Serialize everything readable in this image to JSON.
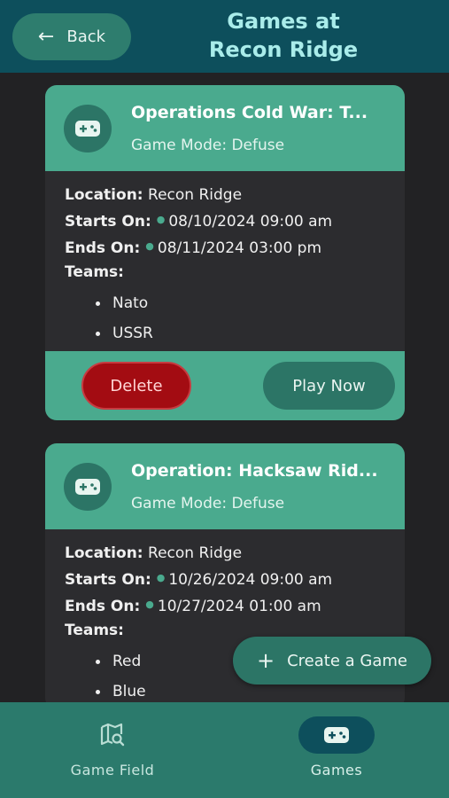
{
  "header": {
    "back_label": "Back",
    "title_line1": "Games at",
    "title_line2": "Recon Ridge"
  },
  "labels": {
    "location": "Location:",
    "starts_on": "Starts On:",
    "ends_on": "Ends On:",
    "teams": "Teams:",
    "delete": "Delete",
    "play_now": "Play Now"
  },
  "games": [
    {
      "title": "Operations Cold War: T...",
      "mode": "Game Mode: Defuse",
      "location": "Recon Ridge",
      "starts": "08/10/2024 09:00 am",
      "ends": "08/11/2024 03:00 pm",
      "teams": [
        "Nato",
        "USSR"
      ]
    },
    {
      "title": "Operation: Hacksaw Rid...",
      "mode": "Game Mode: Defuse",
      "location": "Recon Ridge",
      "starts": "10/26/2024 09:00 am",
      "ends": "10/27/2024 01:00 am",
      "teams": [
        "Red",
        "Blue"
      ]
    }
  ],
  "fab": {
    "label": "Create a Game"
  },
  "nav": {
    "game_field": "Game Field",
    "games": "Games",
    "active": "games"
  },
  "colors": {
    "header_bg": "#0d4f5c",
    "accent": "#4aaa8e",
    "delete": "#a30c12",
    "title": "#a9ecea"
  },
  "icons": {
    "back": "arrow-left-icon",
    "game": "gamepad-icon",
    "plus": "plus-icon",
    "map": "map-search-icon"
  }
}
